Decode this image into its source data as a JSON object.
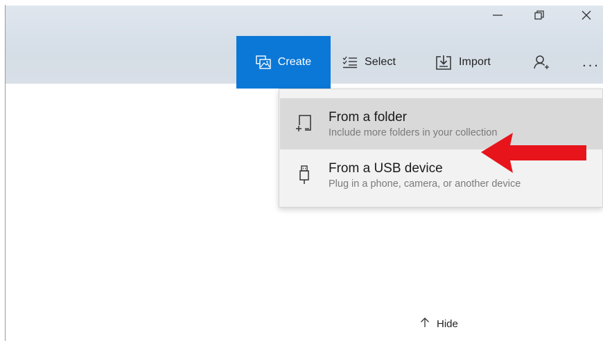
{
  "window": {
    "controls": {
      "minimize_icon": "minimize-icon",
      "restore_icon": "restore-icon",
      "close_icon": "close-icon"
    }
  },
  "toolbar": {
    "create_label": "Create",
    "select_label": "Select",
    "import_label": "Import",
    "more_label": "...",
    "accent_color": "#0b78d7"
  },
  "menu": {
    "items": [
      {
        "title": "From a folder",
        "subtitle": "Include more folders in your collection",
        "icon": "add-folder-icon"
      },
      {
        "title": "From a USB device",
        "subtitle": "Plug in a phone, camera, or another device",
        "icon": "usb-icon"
      }
    ]
  },
  "annotation": {
    "arrow_color": "#e8141b"
  },
  "footer": {
    "hide_label": "Hide"
  }
}
